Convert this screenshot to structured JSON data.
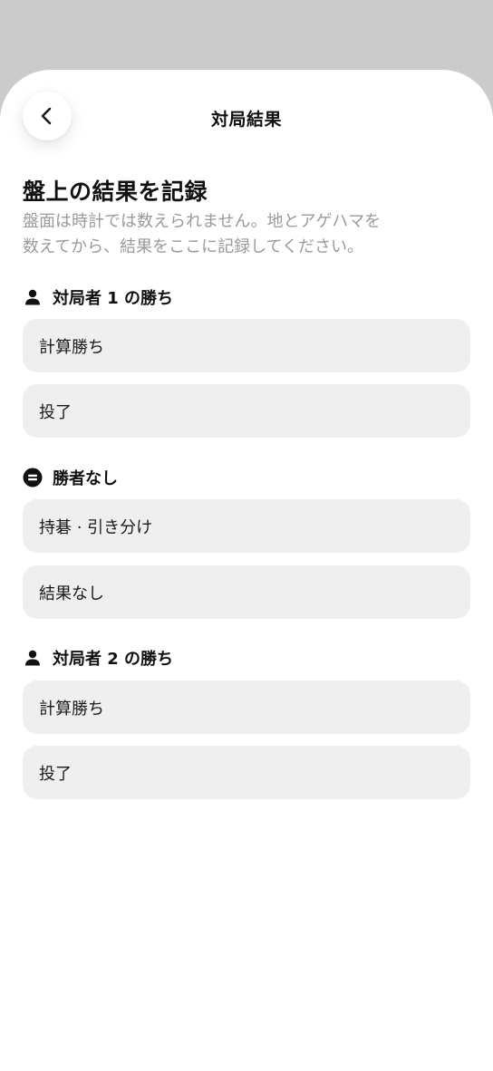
{
  "header": {
    "title": "対局結果"
  },
  "intro": {
    "title": "盤上の結果を記録",
    "subtitle": "盤面は時計では数えられません。地とアゲハマを\n数えてから、結果をここに記録してください。"
  },
  "sections": [
    {
      "header": "対局者 1 の勝ち",
      "icon": "person-icon",
      "options": [
        "計算勝ち",
        "投了"
      ]
    },
    {
      "header": "勝者なし",
      "icon": "equals-circle-icon",
      "options": [
        "持碁 · 引き分け",
        "結果なし"
      ]
    },
    {
      "header": "対局者 2 の勝ち",
      "icon": "person-icon",
      "options": [
        "計算勝ち",
        "投了"
      ]
    }
  ],
  "colors": {
    "backdrop": "#cbcbcb",
    "sheet": "#ffffff",
    "option_bg": "#efefef",
    "subtitle": "#9a9a9a"
  }
}
